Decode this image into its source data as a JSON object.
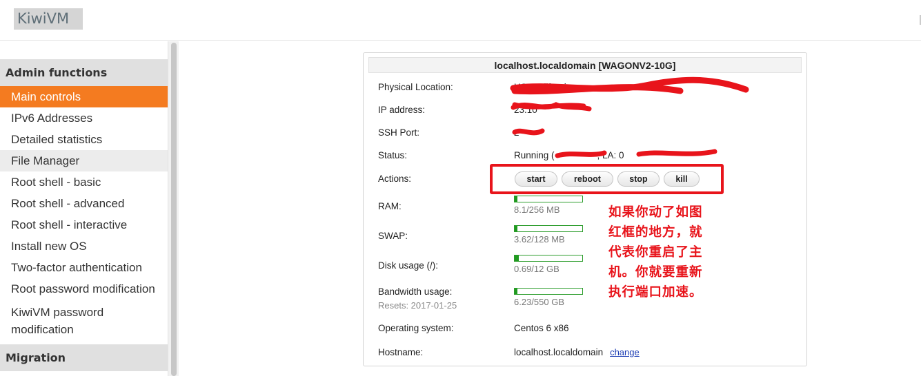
{
  "header": {
    "logo": "KiwiVM"
  },
  "sidebar": {
    "sections": [
      {
        "title": "Admin functions"
      },
      {
        "title": "Migration"
      }
    ],
    "items": [
      {
        "label": "Main controls"
      },
      {
        "label": "IPv6 Addresses"
      },
      {
        "label": "Detailed statistics"
      },
      {
        "label": "File Manager"
      },
      {
        "label": "Root shell - basic"
      },
      {
        "label": "Root shell - advanced"
      },
      {
        "label": "Root shell - interactive"
      },
      {
        "label": "Install new OS"
      },
      {
        "label": "Two-factor authentication"
      },
      {
        "label": "Root password modification"
      },
      {
        "label": "KiwiVM password modification"
      }
    ]
  },
  "panel": {
    "title": "localhost.localdomain   [WAGONV2-10G]",
    "labels": {
      "location": "Physical Location:",
      "ip": "IP address:",
      "ssh": "SSH Port:",
      "status": "Status:",
      "actions": "Actions:",
      "ram": "RAM:",
      "swap": "SWAP:",
      "disk": "Disk usage (/):",
      "bandwidth": "Bandwidth usage:",
      "resets": "Resets: 2017-01-25",
      "os": "Operating system:",
      "hostname": "Hostname:"
    },
    "values": {
      "location": "US, California",
      "ip": "23.10",
      "ssh": "2",
      "status": "Running (",
      "status_tail": "; LA: 0",
      "os": "Centos 6 x86",
      "hostname": "localhost.localdomain",
      "change": "change"
    },
    "buttons": {
      "start": "start",
      "reboot": "reboot",
      "stop": "stop",
      "kill": "kill"
    },
    "usage": {
      "ram": {
        "text": "8.1/256 MB",
        "fraction": 0.032
      },
      "swap": {
        "text": "3.62/128 MB",
        "fraction": 0.028
      },
      "disk": {
        "text": "0.69/12 GB",
        "fraction": 0.058
      },
      "bandwidth": {
        "text": "6.23/550 GB",
        "fraction": 0.011
      }
    }
  },
  "annotation": {
    "lines": [
      "如果你动了如图",
      "红框的地方，就",
      "代表你重启了主",
      "机。你就要重新",
      "执行端口加速。"
    ]
  },
  "colors": {
    "accent": "#f47b20",
    "annotation": "#e8141b",
    "bar": "#1f9a1f"
  }
}
